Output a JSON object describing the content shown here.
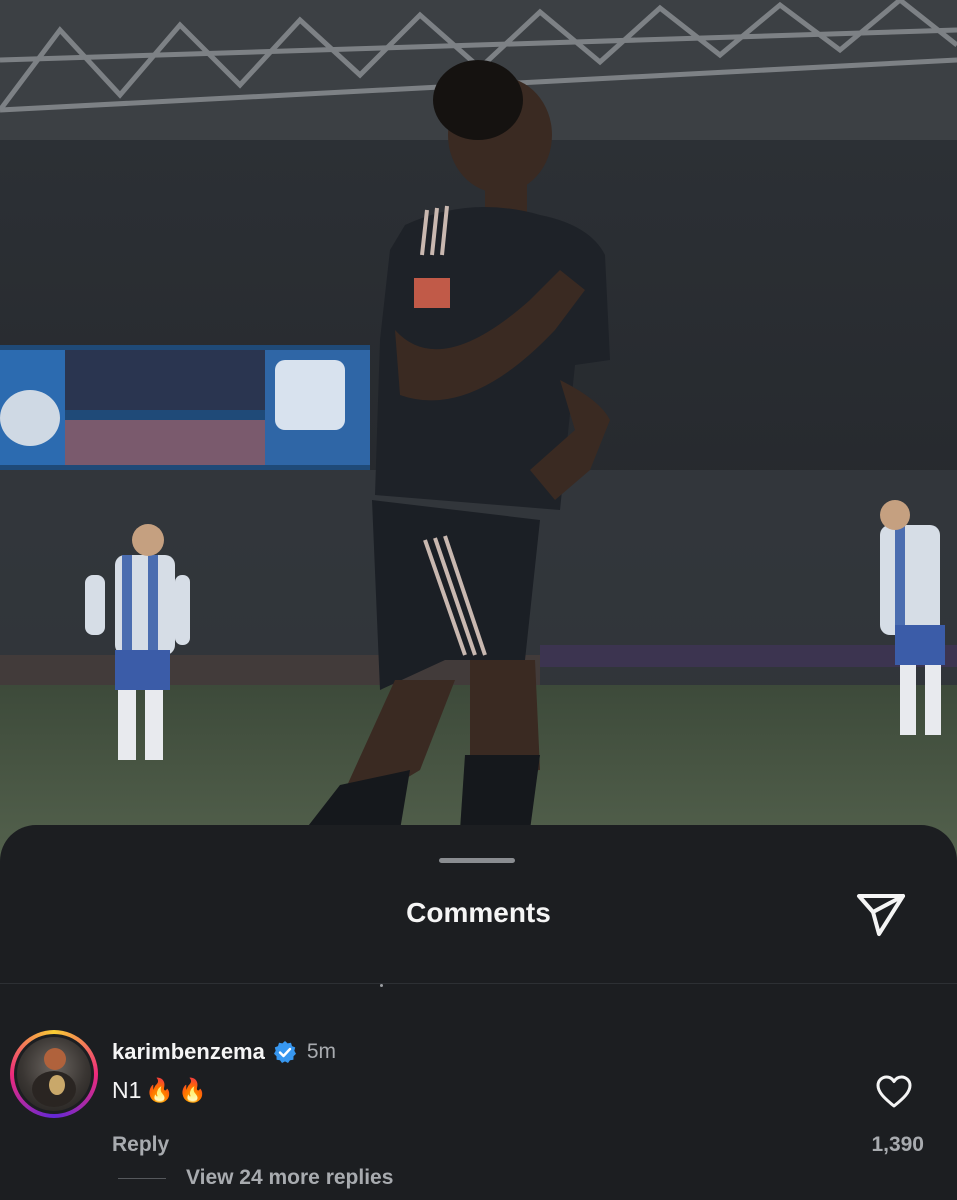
{
  "post": {
    "image_description": "player-celebration-photo"
  },
  "comments_sheet": {
    "title": "Comments",
    "share_icon": "send-icon",
    "comment": {
      "username": "karimbenzema",
      "verified_icon": "verified-badge-icon",
      "timestamp": "5m",
      "text": "N1",
      "emojis": [
        "🔥",
        "🔥"
      ],
      "reply_label": "Reply",
      "like_icon": "heart-icon",
      "like_count": "1,390",
      "view_replies_label": "View 24 more replies"
    }
  },
  "colors": {
    "sheet_bg": "#1c1e21",
    "verified_blue": "#3797f0",
    "secondary_text": "#a8abaf"
  }
}
